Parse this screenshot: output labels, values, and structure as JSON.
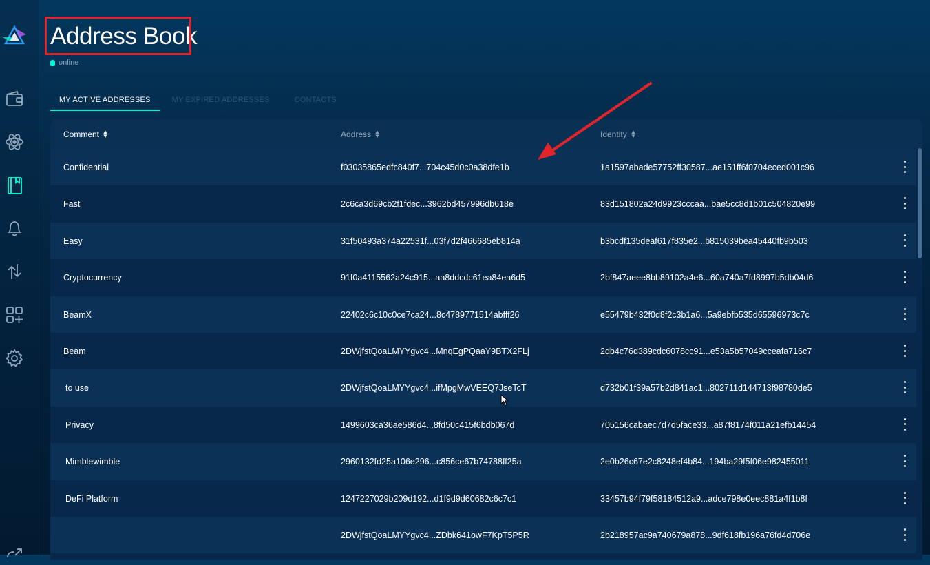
{
  "page": {
    "title": "Address Book",
    "status": "online"
  },
  "tabs": [
    {
      "label": "MY ACTIVE ADDRESSES",
      "active": true
    },
    {
      "label": "MY EXPIRED ADDRESSES",
      "active": false
    },
    {
      "label": "CONTACTS",
      "active": false
    }
  ],
  "table": {
    "columns": [
      {
        "label": "Comment",
        "sortable": true
      },
      {
        "label": "Address",
        "sortable": true
      },
      {
        "label": "Identity",
        "sortable": true
      }
    ],
    "rows": [
      {
        "comment": "Confidential",
        "address": "f03035865edfc840f7...704c45d0c0a38dfe1b",
        "identity": "1a1597abade57752ff30587...ae151ff6f0704eced001c96"
      },
      {
        "comment": "Fast",
        "address": "2c6ca3d69cb2f1fdec...3962bd457996db618e",
        "identity": "83d151802a24d9923cccaa...bae5cc8d1b01c504820e99"
      },
      {
        "comment": "Easy",
        "address": "31f50493a374a22531f...03f7d2f466685eb814a",
        "identity": "b3bcdf135deaf617f835e2...b815039bea45440fb9b503"
      },
      {
        "comment": "Cryptocurrency",
        "address": "91f0a4115562a24c915...aa8ddcdc61ea84ea6d5",
        "identity": "2bf847aeee8bb89102a4e6...60a740a7fd8997b5db04d6"
      },
      {
        "comment": "BeamX",
        "address": "22402c6c10c0ce7ca24...8c4789771514abfff26",
        "identity": "e55479b432f0d8f2c3b1a6...5a9ebfb535d65596973c7c"
      },
      {
        "comment": "Beam",
        "address": "2DWjfstQoaLMYYgvc4...MnqEgPQaaY9BTX2FLj",
        "identity": "2db4c76d389cdc6078cc91...e53a5b57049cceafa716c7"
      },
      {
        "comment": "to use",
        "address": "2DWjfstQoaLMYYgvc4...ifMpgMwVEEQ7JseTcT",
        "identity": "d732b01f39a57b2d841ac1...802711d144713f98780de5"
      },
      {
        "comment": "Privacy",
        "address": "1499603ca36ae586d4...8fd50c415f6bdb067d",
        "identity": "705156cabaec7d7d5face33...a87f8174f011a21efb14454"
      },
      {
        "comment": "Mimblewimble",
        "address": "2960132fd25a106e296...c856ce67b74788ff25a",
        "identity": "2e0b26c67e2c8248ef4b84...194ba29f5f06e982455011"
      },
      {
        "comment": "DeFi Platform",
        "address": "1247227029b209d192...d1f9d9d60682c6c7c1",
        "identity": "33457b94f79f58184512a9...adce798e0eec881a4f1b8f"
      },
      {
        "comment": "",
        "address": "2DWjfstQoaLMYYgvc4...ZDbk641owF7KpT5P5R",
        "identity": "2b218957ac9a740679a878...9df618fb196a76fd4d706e"
      }
    ]
  },
  "sidebar": {
    "items": [
      {
        "icon": "wallet-icon"
      },
      {
        "icon": "atom-icon"
      },
      {
        "icon": "address-book-icon",
        "active": true
      },
      {
        "icon": "bell-icon"
      },
      {
        "icon": "transfer-arrows-icon"
      },
      {
        "icon": "apps-add-icon"
      },
      {
        "icon": "gear-icon"
      }
    ]
  },
  "colors": {
    "accent": "#00f6d2",
    "annotation": "#e3242b",
    "row_alt": "#0c3156",
    "panel": "#07284a"
  }
}
